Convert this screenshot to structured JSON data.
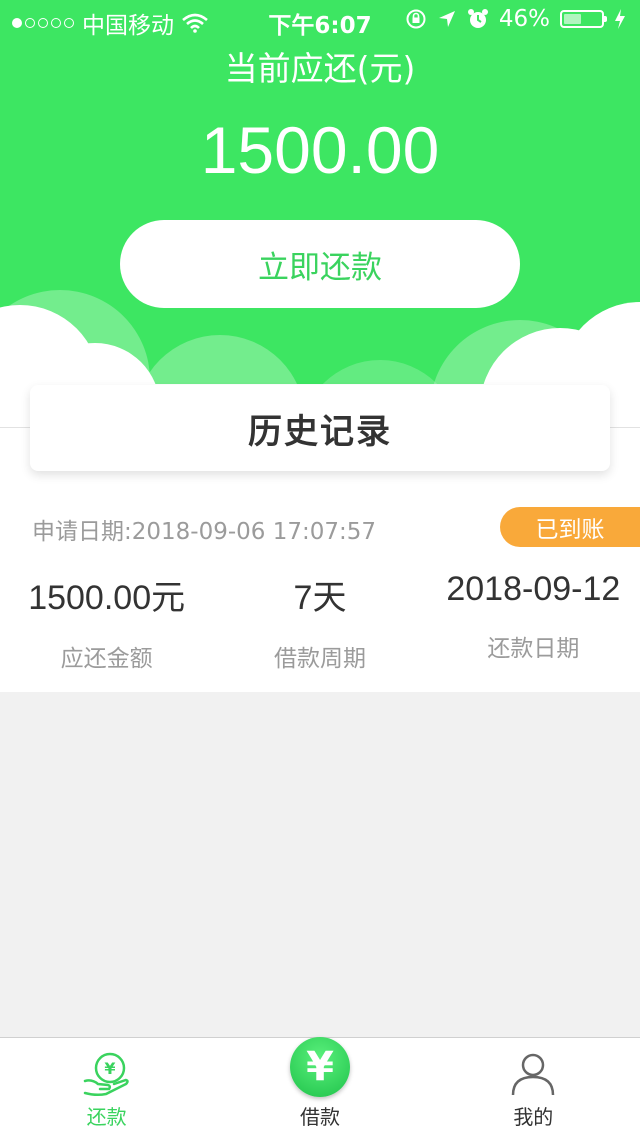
{
  "status_bar": {
    "carrier": "中国移动",
    "time": "下午6:07",
    "battery": "46%",
    "battery_level": 0.46
  },
  "header": {
    "due_label": "当前应还(元)",
    "due_amount": "1500.00",
    "repay_button": "立即还款"
  },
  "history": {
    "title": "历史记录",
    "records": [
      {
        "apply_date": "申请日期:2018-09-06 17:07:57",
        "status": "已到账",
        "amount": "1500.00元",
        "amount_label": "应还金额",
        "period": "7天",
        "period_label": "借款周期",
        "repay_date": "2018-09-12",
        "repay_date_label": "还款日期"
      }
    ]
  },
  "tabbar": {
    "items": [
      {
        "label": "还款",
        "icon": "repay-hand-yuan-icon",
        "active": true
      },
      {
        "label": "借款",
        "icon": "yuan-circle-icon",
        "active": false
      },
      {
        "label": "我的",
        "icon": "user-icon",
        "active": false
      }
    ]
  },
  "colors": {
    "brand_green": "#3de662",
    "badge_orange": "#f9a93a"
  }
}
